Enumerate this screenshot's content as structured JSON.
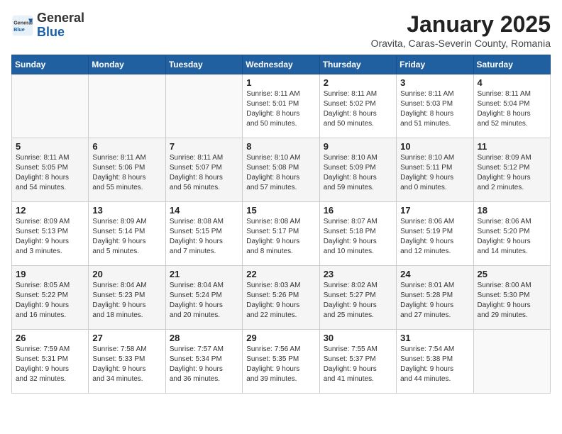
{
  "logo": {
    "general": "General",
    "blue": "Blue"
  },
  "title": "January 2025",
  "subtitle": "Oravita, Caras-Severin County, Romania",
  "headers": [
    "Sunday",
    "Monday",
    "Tuesday",
    "Wednesday",
    "Thursday",
    "Friday",
    "Saturday"
  ],
  "weeks": [
    [
      {
        "day": "",
        "info": ""
      },
      {
        "day": "",
        "info": ""
      },
      {
        "day": "",
        "info": ""
      },
      {
        "day": "1",
        "info": "Sunrise: 8:11 AM\nSunset: 5:01 PM\nDaylight: 8 hours\nand 50 minutes."
      },
      {
        "day": "2",
        "info": "Sunrise: 8:11 AM\nSunset: 5:02 PM\nDaylight: 8 hours\nand 50 minutes."
      },
      {
        "day": "3",
        "info": "Sunrise: 8:11 AM\nSunset: 5:03 PM\nDaylight: 8 hours\nand 51 minutes."
      },
      {
        "day": "4",
        "info": "Sunrise: 8:11 AM\nSunset: 5:04 PM\nDaylight: 8 hours\nand 52 minutes."
      }
    ],
    [
      {
        "day": "5",
        "info": "Sunrise: 8:11 AM\nSunset: 5:05 PM\nDaylight: 8 hours\nand 54 minutes."
      },
      {
        "day": "6",
        "info": "Sunrise: 8:11 AM\nSunset: 5:06 PM\nDaylight: 8 hours\nand 55 minutes."
      },
      {
        "day": "7",
        "info": "Sunrise: 8:11 AM\nSunset: 5:07 PM\nDaylight: 8 hours\nand 56 minutes."
      },
      {
        "day": "8",
        "info": "Sunrise: 8:10 AM\nSunset: 5:08 PM\nDaylight: 8 hours\nand 57 minutes."
      },
      {
        "day": "9",
        "info": "Sunrise: 8:10 AM\nSunset: 5:09 PM\nDaylight: 8 hours\nand 59 minutes."
      },
      {
        "day": "10",
        "info": "Sunrise: 8:10 AM\nSunset: 5:11 PM\nDaylight: 9 hours\nand 0 minutes."
      },
      {
        "day": "11",
        "info": "Sunrise: 8:09 AM\nSunset: 5:12 PM\nDaylight: 9 hours\nand 2 minutes."
      }
    ],
    [
      {
        "day": "12",
        "info": "Sunrise: 8:09 AM\nSunset: 5:13 PM\nDaylight: 9 hours\nand 3 minutes."
      },
      {
        "day": "13",
        "info": "Sunrise: 8:09 AM\nSunset: 5:14 PM\nDaylight: 9 hours\nand 5 minutes."
      },
      {
        "day": "14",
        "info": "Sunrise: 8:08 AM\nSunset: 5:15 PM\nDaylight: 9 hours\nand 7 minutes."
      },
      {
        "day": "15",
        "info": "Sunrise: 8:08 AM\nSunset: 5:17 PM\nDaylight: 9 hours\nand 8 minutes."
      },
      {
        "day": "16",
        "info": "Sunrise: 8:07 AM\nSunset: 5:18 PM\nDaylight: 9 hours\nand 10 minutes."
      },
      {
        "day": "17",
        "info": "Sunrise: 8:06 AM\nSunset: 5:19 PM\nDaylight: 9 hours\nand 12 minutes."
      },
      {
        "day": "18",
        "info": "Sunrise: 8:06 AM\nSunset: 5:20 PM\nDaylight: 9 hours\nand 14 minutes."
      }
    ],
    [
      {
        "day": "19",
        "info": "Sunrise: 8:05 AM\nSunset: 5:22 PM\nDaylight: 9 hours\nand 16 minutes."
      },
      {
        "day": "20",
        "info": "Sunrise: 8:04 AM\nSunset: 5:23 PM\nDaylight: 9 hours\nand 18 minutes."
      },
      {
        "day": "21",
        "info": "Sunrise: 8:04 AM\nSunset: 5:24 PM\nDaylight: 9 hours\nand 20 minutes."
      },
      {
        "day": "22",
        "info": "Sunrise: 8:03 AM\nSunset: 5:26 PM\nDaylight: 9 hours\nand 22 minutes."
      },
      {
        "day": "23",
        "info": "Sunrise: 8:02 AM\nSunset: 5:27 PM\nDaylight: 9 hours\nand 25 minutes."
      },
      {
        "day": "24",
        "info": "Sunrise: 8:01 AM\nSunset: 5:28 PM\nDaylight: 9 hours\nand 27 minutes."
      },
      {
        "day": "25",
        "info": "Sunrise: 8:00 AM\nSunset: 5:30 PM\nDaylight: 9 hours\nand 29 minutes."
      }
    ],
    [
      {
        "day": "26",
        "info": "Sunrise: 7:59 AM\nSunset: 5:31 PM\nDaylight: 9 hours\nand 32 minutes."
      },
      {
        "day": "27",
        "info": "Sunrise: 7:58 AM\nSunset: 5:33 PM\nDaylight: 9 hours\nand 34 minutes."
      },
      {
        "day": "28",
        "info": "Sunrise: 7:57 AM\nSunset: 5:34 PM\nDaylight: 9 hours\nand 36 minutes."
      },
      {
        "day": "29",
        "info": "Sunrise: 7:56 AM\nSunset: 5:35 PM\nDaylight: 9 hours\nand 39 minutes."
      },
      {
        "day": "30",
        "info": "Sunrise: 7:55 AM\nSunset: 5:37 PM\nDaylight: 9 hours\nand 41 minutes."
      },
      {
        "day": "31",
        "info": "Sunrise: 7:54 AM\nSunset: 5:38 PM\nDaylight: 9 hours\nand 44 minutes."
      },
      {
        "day": "",
        "info": ""
      }
    ]
  ]
}
